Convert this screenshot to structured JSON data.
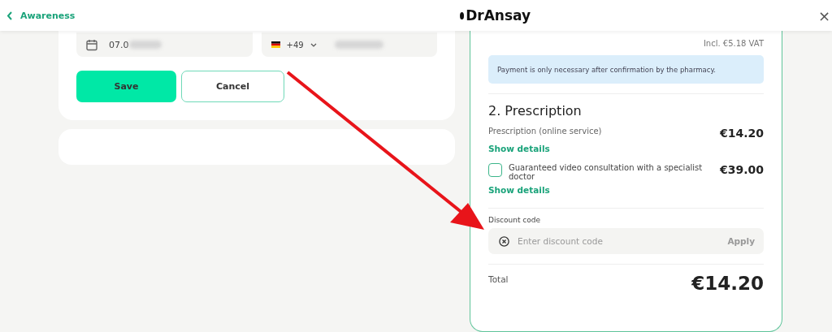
{
  "header": {
    "back_link": "Awareness",
    "logo": "DrAnsay",
    "close": "×"
  },
  "form": {
    "date_value": "07.0",
    "date_redacted": true,
    "phone_code": "+49",
    "phone_redacted": true,
    "buttons": [
      {
        "label": "Save",
        "kind": "primary"
      },
      {
        "label": "Cancel",
        "kind": "secondary"
      }
    ]
  },
  "summary": {
    "vat_note": "Incl. €5.18 VAT",
    "info": "Payment is only necessary after confirmation by the pharmacy.",
    "section_title": "2. Prescription",
    "items": [
      {
        "label": "Prescription (online service)",
        "price": "€14.20",
        "kind": "fixed",
        "details_link": "Show details"
      },
      {
        "label": "Guaranteed video consultation with a specialist doctor",
        "price": "€39.00",
        "kind": "optional",
        "checked": false,
        "details_link": "Show details"
      }
    ],
    "discount": {
      "label": "Discount code",
      "placeholder": "Enter discount code",
      "button": "Apply"
    },
    "total_label": "Total",
    "total_value": "€14.20"
  }
}
